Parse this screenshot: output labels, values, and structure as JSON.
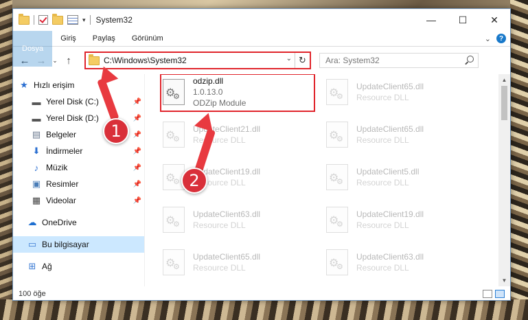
{
  "window": {
    "title": "System32",
    "minimize": "—",
    "maximize": "☐",
    "close": "✕"
  },
  "ribbon": {
    "tabs": [
      "Dosya",
      "Giriş",
      "Paylaş",
      "Görünüm"
    ],
    "expand": "⌄",
    "help": "?"
  },
  "nav": {
    "back": "←",
    "forward": "→",
    "recent": "⌄",
    "up": "↑"
  },
  "address": {
    "path": "C:\\Windows\\System32",
    "dropdown": "⌄",
    "refresh": "↻"
  },
  "search": {
    "placeholder": "Ara: System32"
  },
  "sidebar": {
    "items": [
      {
        "label": "Hızlı erişim",
        "icon": "star-icon",
        "glyph": "★",
        "color": "#2b6fd1",
        "pinned": false
      },
      {
        "label": "Yerel Disk (C:)",
        "icon": "drive-icon",
        "glyph": "▬",
        "color": "#555555",
        "pinned": true
      },
      {
        "label": "Yerel Disk (D:)",
        "icon": "drive-icon",
        "glyph": "▬",
        "color": "#555555",
        "pinned": true
      },
      {
        "label": "Belgeler",
        "icon": "document-icon",
        "glyph": "▤",
        "color": "#6b7a8f",
        "pinned": true
      },
      {
        "label": "İndirmeler",
        "icon": "download-icon",
        "glyph": "⬇",
        "color": "#2b6fd1",
        "pinned": true
      },
      {
        "label": "Müzik",
        "icon": "music-icon",
        "glyph": "♪",
        "color": "#2b6fd1",
        "pinned": true
      },
      {
        "label": "Resimler",
        "icon": "pictures-icon",
        "glyph": "▣",
        "color": "#4a7db7",
        "pinned": true
      },
      {
        "label": "Videolar",
        "icon": "video-icon",
        "glyph": "▦",
        "color": "#444444",
        "pinned": true
      },
      {
        "label": "OneDrive",
        "icon": "cloud-icon",
        "glyph": "☁",
        "color": "#1e6fd0",
        "pinned": false
      },
      {
        "label": "Bu bilgisayar",
        "icon": "computer-icon",
        "glyph": "▭",
        "color": "#3b7bd4",
        "pinned": false
      },
      {
        "label": "Ağ",
        "icon": "network-icon",
        "glyph": "⊞",
        "color": "#3b7bd4",
        "pinned": false
      }
    ]
  },
  "files": [
    {
      "name": "odzip.dll",
      "line2": "1.0.13.0",
      "line3": "ODZip Module"
    },
    {
      "name": "UpdateClient65.dll",
      "line2": "Resource DLL",
      "line3": ""
    },
    {
      "name": "UpdateClient21.dll",
      "line2": "Resource DLL",
      "line3": ""
    },
    {
      "name": "UpdateClient65.dll",
      "line2": "Resource DLL",
      "line3": ""
    },
    {
      "name": "UpdateClient19.dll",
      "line2": "Resource DLL",
      "line3": ""
    },
    {
      "name": "UpdateClient5.dll",
      "line2": "Resource DLL",
      "line3": ""
    },
    {
      "name": "UpdateClient63.dll",
      "line2": "Resource DLL",
      "line3": ""
    },
    {
      "name": "UpdateClient19.dll",
      "line2": "Resource DLL",
      "line3": ""
    },
    {
      "name": "UpdateClient65.dll",
      "line2": "Resource DLL",
      "line3": ""
    },
    {
      "name": "UpdateClient63.dll",
      "line2": "Resource DLL",
      "line3": ""
    }
  ],
  "status": {
    "count": "100 öğe"
  },
  "annotations": {
    "step1": "1",
    "step2": "2",
    "color": "#e0242b"
  }
}
